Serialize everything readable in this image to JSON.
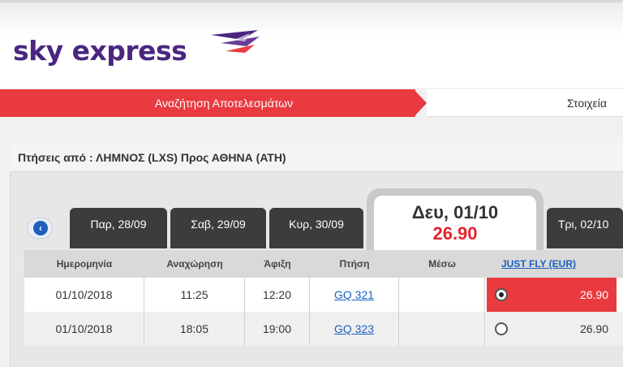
{
  "brand": {
    "name": "sky express",
    "logo_color": "#4a2680",
    "accent": "#e83a3f"
  },
  "steps": {
    "active": "Αναζήτηση Αποτελεσμάτων",
    "next": "Στοιχεία"
  },
  "route": {
    "text": "Πτήσεις από : ΛΗΜΝΟΣ (LXS) Προς ΑΘΗΝΑ (ΑΤΗ)"
  },
  "date_tabs": [
    {
      "label": "Παρ, 28/09"
    },
    {
      "label": "Σαβ, 29/09"
    },
    {
      "label": "Κυρ, 30/09"
    },
    {
      "label": "Δευ, 01/10",
      "price": "26.90",
      "selected": true
    },
    {
      "label": "Τρι, 02/10"
    }
  ],
  "table": {
    "headers": [
      "Ημερομηνία",
      "Αναχώρηση",
      "Άφιξη",
      "Πτήση",
      "Μέσω",
      "JUST FLY (EUR)"
    ],
    "rows": [
      {
        "date": "01/10/2018",
        "departure": "11:25",
        "arrival": "12:20",
        "flight": "GQ 321",
        "via": "",
        "price": "26.90",
        "selected": true
      },
      {
        "date": "01/10/2018",
        "departure": "18:05",
        "arrival": "19:00",
        "flight": "GQ 323",
        "via": "",
        "price": "26.90",
        "selected": false
      }
    ]
  }
}
